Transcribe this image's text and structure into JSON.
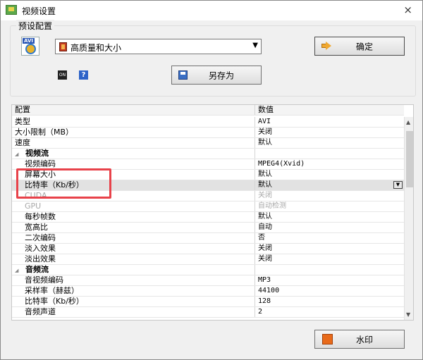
{
  "window": {
    "title": "视频设置",
    "close_label": "×"
  },
  "preset": {
    "group_label": "预设配置",
    "selected": "高质量和大小",
    "ok_label": "确定",
    "save_as_label": "另存为",
    "on_icon_text": "ON",
    "help_icon_text": "?"
  },
  "grid": {
    "col_config": "配置",
    "col_value": "数值",
    "rows": [
      {
        "key": "类型",
        "value": "AVI"
      },
      {
        "key": "大小限制（MB）",
        "value": "关闭"
      },
      {
        "key": "速度",
        "value": "默认"
      },
      {
        "key": "视频流",
        "value": ""
      },
      {
        "key": "视频编码",
        "value": "MPEG4(Xvid)"
      },
      {
        "key": "屏幕大小",
        "value": "默认"
      },
      {
        "key": "比特率（Kb/秒）",
        "value": "默认"
      },
      {
        "key": "CUDA",
        "value": "关闭"
      },
      {
        "key": "GPU",
        "value": "自动检测"
      },
      {
        "key": "每秒帧数",
        "value": "默认"
      },
      {
        "key": "宽高比",
        "value": "自动"
      },
      {
        "key": "二次编码",
        "value": "否"
      },
      {
        "key": "淡入效果",
        "value": "关闭"
      },
      {
        "key": "淡出效果",
        "value": "关闭"
      },
      {
        "key": "音频流",
        "value": ""
      },
      {
        "key": "音视频编码",
        "value": "MP3"
      },
      {
        "key": "采样率（赫兹）",
        "value": "44100"
      },
      {
        "key": "比特率（Kb/秒）",
        "value": "128"
      },
      {
        "key": "音频声道",
        "value": "2"
      }
    ]
  },
  "watermark_label": "水印"
}
